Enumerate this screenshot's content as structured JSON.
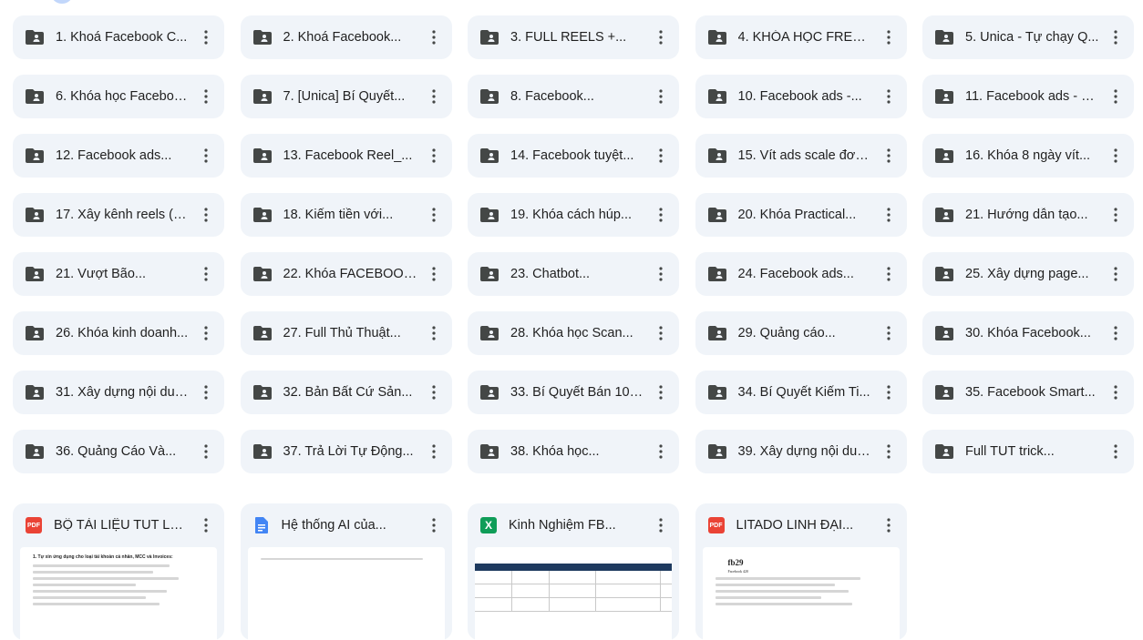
{
  "folders": [
    {
      "name": "1. Khoá Facebook C..."
    },
    {
      "name": "2. Khoá Facebook..."
    },
    {
      "name": "3. FULL REELS +..."
    },
    {
      "name": "4. KHÓA HỌC FREE..."
    },
    {
      "name": "5. Unica - Tự chạy Q..."
    },
    {
      "name": "6. Khóa học Faceboo..."
    },
    {
      "name": "7. [Unica] Bí Quyết..."
    },
    {
      "name": "8. Facebook..."
    },
    {
      "name": "10. Facebook ads -..."
    },
    {
      "name": "11. Facebook ads - H..."
    },
    {
      "name": "12. Facebook ads..."
    },
    {
      "name": "13. Facebook Reel_..."
    },
    {
      "name": "14. Facebook tuyệt..."
    },
    {
      "name": "15. Vít ads scale đơn..."
    },
    {
      "name": "16. Khóa 8 ngày vít..."
    },
    {
      "name": "17. Xây kênh reels (5..."
    },
    {
      "name": "18. Kiếm tiền với..."
    },
    {
      "name": "19. Khóa cách húp..."
    },
    {
      "name": "20. Khóa Practical..."
    },
    {
      "name": "21. Hướng dẫn tạo..."
    },
    {
      "name": "21. Vượt Bão..."
    },
    {
      "name": "22. Khóa FACEBOOK..."
    },
    {
      "name": "23. Chatbot..."
    },
    {
      "name": "24. Facebook ads..."
    },
    {
      "name": "25. Xây dựng page..."
    },
    {
      "name": "26. Khóa kinh doanh..."
    },
    {
      "name": "27. Full Thủ Thuật..."
    },
    {
      "name": "28. Khóa học Scan..."
    },
    {
      "name": "29. Quảng cáo..."
    },
    {
      "name": "30. Khóa Facebook..."
    },
    {
      "name": "31. Xây dựng nội dun..."
    },
    {
      "name": "32. Bản Bất Cứ Sản..."
    },
    {
      "name": "33. Bí Quyết Bán 100..."
    },
    {
      "name": "34. Bí Quyết Kiếm Ti..."
    },
    {
      "name": "35. Facebook Smart..."
    },
    {
      "name": "36. Quảng Cáo Và..."
    },
    {
      "name": "37. Trả Lời Tự Động..."
    },
    {
      "name": "38. Khóa học..."
    },
    {
      "name": "39. Xây dựng nội dun..."
    },
    {
      "name": "Full TUT trick..."
    }
  ],
  "files": [
    {
      "name": "BỘ TÀI LIỆU TUT LÊN...",
      "type": "pdf",
      "badge": "PDF",
      "badge_color": "#ea4335"
    },
    {
      "name": "Hệ thống AI của...",
      "type": "doc",
      "badge": "",
      "badge_color": "#4285f4"
    },
    {
      "name": "Kinh Nghiệm FB...",
      "type": "sheet",
      "badge": "X",
      "badge_color": "#0f9d58"
    },
    {
      "name": "LITADO LINH ĐẠI...",
      "type": "pdf",
      "badge": "PDF",
      "badge_color": "#ea4335"
    }
  ],
  "thumbs": {
    "pdf1_heading": "1. Tự xin ứng dụng cho loại tài khoản cá nhân, MCC và Invoices:",
    "pdf2_heading": "fb29",
    "pdf2_sub": "Facebook 420"
  },
  "colors": {
    "tile_bg": "#f0f4f9",
    "icon": "#444746"
  }
}
